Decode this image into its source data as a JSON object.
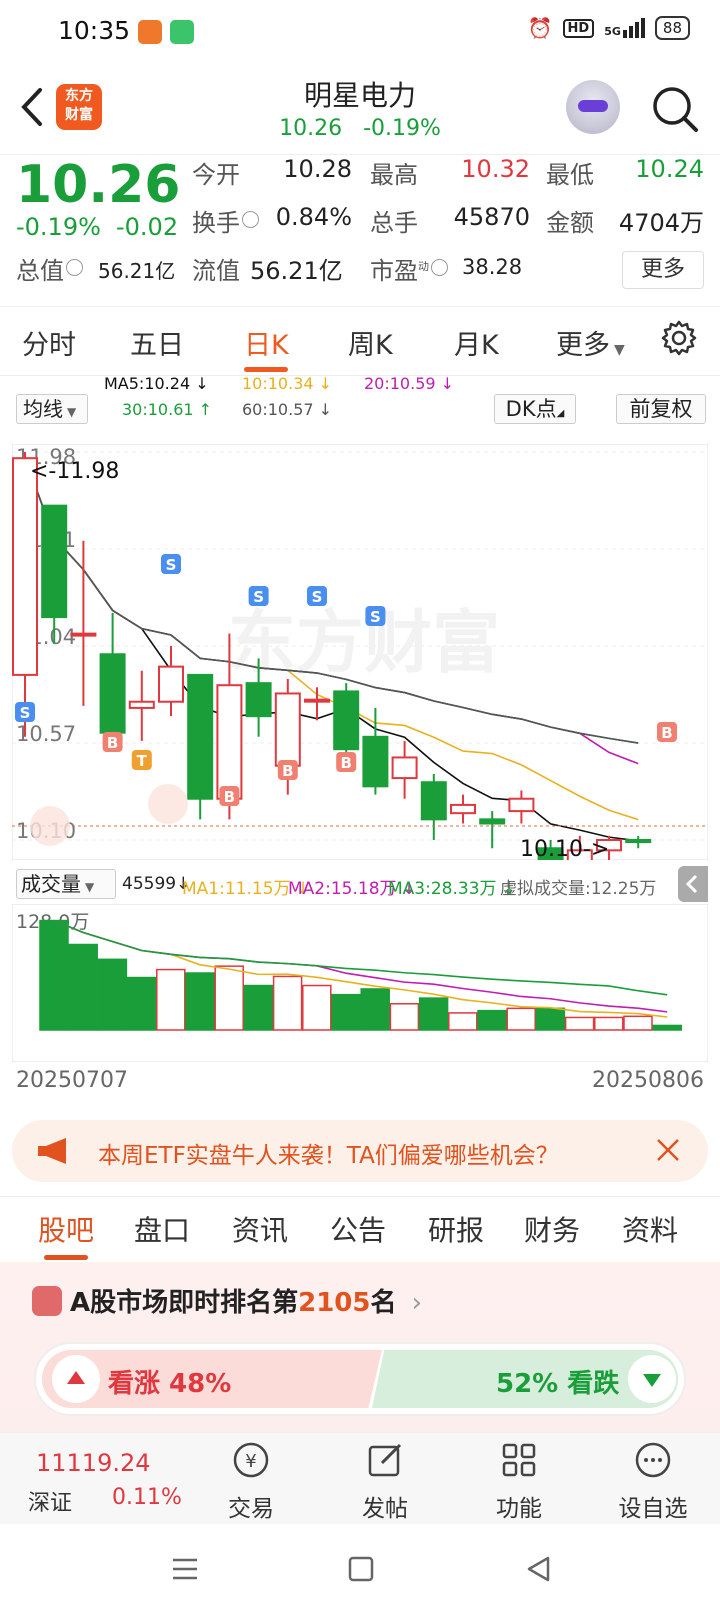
{
  "status": {
    "time": "10:35",
    "battery": "88",
    "network": "5G",
    "hd": "HD"
  },
  "header": {
    "title": "明星电力",
    "price": "10.26",
    "change_pct": "-0.19%",
    "logo_line1": "东方",
    "logo_line2": "财富"
  },
  "quote": {
    "price": "10.26",
    "change_pct": "-0.19%",
    "change": "-0.02",
    "open_label": "今开",
    "open": "10.28",
    "high_label": "最高",
    "high": "10.32",
    "low_label": "最低",
    "low": "10.24",
    "turnover_label": "换手",
    "turnover": "0.84%",
    "volume_label": "总手",
    "volume": "45870",
    "amount_label": "金额",
    "amount": "4704万",
    "mktcap_label": "总值",
    "mktcap": "56.21亿",
    "float_label": "流值",
    "float": "56.21亿",
    "pe_label": "市盈",
    "pe_sup": "动",
    "pe": "38.28",
    "more": "更多"
  },
  "tabs": [
    "分时",
    "五日",
    "日K",
    "周K",
    "月K",
    "更多"
  ],
  "ma": {
    "selector": "均线",
    "ma5": "MA5:10.24",
    "ma10": "10:10.34",
    "ma20": "20:10.59",
    "ma30": "30:10.61",
    "ma60": "60:10.57",
    "dk": "DK点",
    "fq": "前复权"
  },
  "chart_data": {
    "type": "candlestick",
    "y_ticks": [
      "11.98",
      "11.51",
      "11.04",
      "10.57",
      "10.10"
    ],
    "ylim": [
      10.1,
      11.98
    ],
    "high_marker": "<-11.98",
    "low_marker": "10.10->",
    "candles": [
      {
        "o": 10.9,
        "c": 11.95,
        "h": 11.98,
        "l": 10.6,
        "up": true
      },
      {
        "o": 11.72,
        "c": 11.18,
        "h": 11.72,
        "l": 11.05,
        "up": false
      },
      {
        "o": 11.1,
        "c": 11.1,
        "h": 11.55,
        "l": 10.75,
        "up": true
      },
      {
        "o": 11.0,
        "c": 10.62,
        "h": 11.2,
        "l": 10.55,
        "up": false
      },
      {
        "o": 10.74,
        "c": 10.77,
        "h": 10.92,
        "l": 10.58,
        "up": true
      },
      {
        "o": 10.77,
        "c": 10.94,
        "h": 11.04,
        "l": 10.7,
        "up": true
      },
      {
        "o": 10.9,
        "c": 10.3,
        "h": 10.9,
        "l": 10.2,
        "up": false
      },
      {
        "o": 10.3,
        "c": 10.85,
        "h": 11.1,
        "l": 10.2,
        "up": true
      },
      {
        "o": 10.86,
        "c": 10.7,
        "h": 10.98,
        "l": 10.6,
        "up": false
      },
      {
        "o": 10.46,
        "c": 10.81,
        "h": 10.88,
        "l": 10.32,
        "up": true
      },
      {
        "o": 10.78,
        "c": 10.78,
        "h": 10.84,
        "l": 10.68,
        "up": true
      },
      {
        "o": 10.82,
        "c": 10.54,
        "h": 10.86,
        "l": 10.46,
        "up": false
      },
      {
        "o": 10.6,
        "c": 10.36,
        "h": 10.74,
        "l": 10.32,
        "up": false
      },
      {
        "o": 10.4,
        "c": 10.5,
        "h": 10.58,
        "l": 10.3,
        "up": true
      },
      {
        "o": 10.38,
        "c": 10.2,
        "h": 10.42,
        "l": 10.1,
        "up": false
      },
      {
        "o": 10.23,
        "c": 10.27,
        "h": 10.32,
        "l": 10.18,
        "up": true
      },
      {
        "o": 10.2,
        "c": 10.18,
        "h": 10.24,
        "l": 10.06,
        "up": false
      },
      {
        "o": 10.24,
        "c": 10.3,
        "h": 10.34,
        "l": 10.18,
        "up": true
      },
      {
        "o": 10.06,
        "c": 9.94,
        "h": 10.1,
        "l": 9.9,
        "up": false
      },
      {
        "o": 9.94,
        "c": 10.05,
        "h": 10.12,
        "l": 9.92,
        "up": true
      },
      {
        "o": 10.05,
        "c": 10.1,
        "h": 10.12,
        "l": 10.0,
        "up": true
      },
      {
        "o": 10.1,
        "c": 10.09,
        "h": 10.12,
        "l": 10.06,
        "up": false
      }
    ],
    "signals_s": [
      "S",
      "S",
      "S",
      "S",
      "S"
    ],
    "signals_b": [
      "B",
      "B",
      "B",
      "B",
      "B",
      "B"
    ],
    "signal_t": "T",
    "lines": {
      "ma5_color": "#111111",
      "ma10_color": "#e8b21e",
      "ma20_color": "#c21cb0",
      "ma30_color": "#1a9e3a",
      "ma60_color": "#555555"
    }
  },
  "volume": {
    "selector": "成交量",
    "vol": "45599",
    "ma1": "MA1:11.15万",
    "ma2": "MA2:15.18万",
    "ma3": "MA3:28.33万",
    "virtual": "虚拟成交量:12.25万",
    "max_label": "128.0万",
    "bars": [
      96,
      75,
      62,
      46,
      53,
      50,
      56,
      39,
      47,
      39,
      31,
      36,
      23,
      28,
      15,
      17,
      19,
      19,
      11,
      11,
      12,
      4
    ],
    "bar_up": [
      false,
      false,
      false,
      false,
      true,
      false,
      true,
      false,
      true,
      true,
      false,
      false,
      true,
      false,
      true,
      false,
      true,
      false,
      true,
      true,
      true,
      false
    ],
    "date_start": "20250707",
    "date_end": "20250806"
  },
  "banner": {
    "text": "本周ETF实盘牛人来袭！TA们偏爱哪些机会？"
  },
  "section_tabs": [
    "股吧",
    "盘口",
    "资讯",
    "公告",
    "研报",
    "财务",
    "资料"
  ],
  "rank": {
    "prefix": "A股市场即时排名第",
    "num": "2105",
    "suffix": "名"
  },
  "vote": {
    "up": "看涨 48%",
    "down": "52% 看跌"
  },
  "bottom": {
    "index_value": "11119.24",
    "index_name": "深证",
    "index_change": "0.11%",
    "trade": "交易",
    "post": "发帖",
    "func": "功能",
    "watch": "设自选"
  },
  "colors": {
    "up": "#e0383e",
    "down": "#1a9e3a",
    "accent": "#f05a21"
  }
}
